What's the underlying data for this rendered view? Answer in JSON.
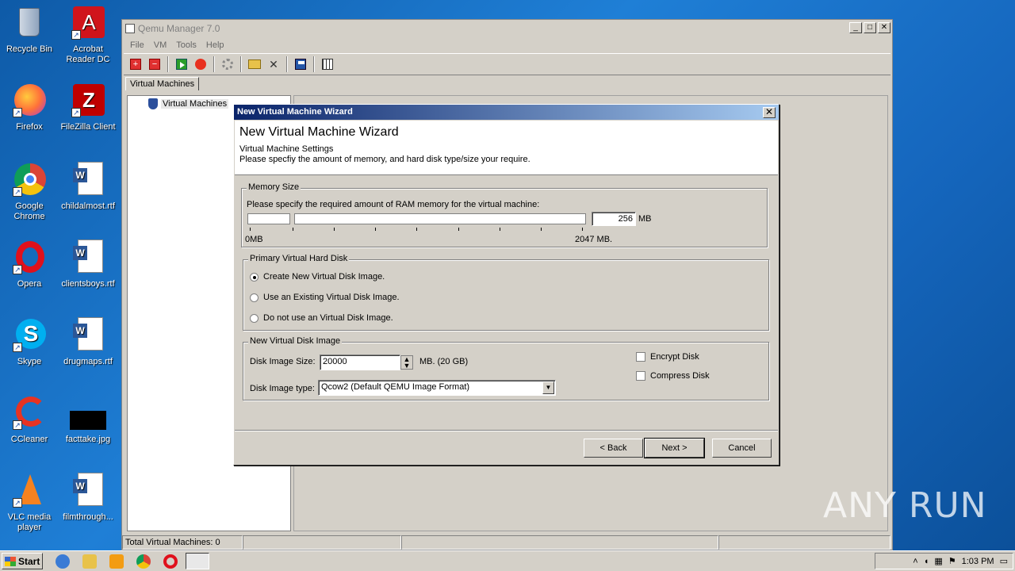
{
  "desktop": {
    "icons": [
      {
        "label": "Recycle Bin"
      },
      {
        "label": "Acrobat Reader DC"
      },
      {
        "label": "Firefox"
      },
      {
        "label": "FileZilla Client"
      },
      {
        "label": "Google Chrome"
      },
      {
        "label": "childalmost.rtf"
      },
      {
        "label": "Opera"
      },
      {
        "label": "clientsboys.rtf"
      },
      {
        "label": "Skype"
      },
      {
        "label": "drugmaps.rtf"
      },
      {
        "label": "CCleaner"
      },
      {
        "label": "facttake.jpg"
      },
      {
        "label": "VLC media player"
      },
      {
        "label": "filmthrough..."
      }
    ]
  },
  "app": {
    "title": "Qemu Manager 7.0",
    "menu": [
      "File",
      "VM",
      "Tools",
      "Help"
    ],
    "tab": "Virtual Machines",
    "tree_root": "Virtual Machines",
    "status": "Total Virtual Machines: 0"
  },
  "dialog": {
    "title_bar": "New Virtual Machine Wizard",
    "heading": "New Virtual Machine Wizard",
    "subheading": "Virtual Machine Settings",
    "description": "Please specfiy the amount of memory, and hard disk type/size your require.",
    "memory": {
      "group_title": "Memory Size",
      "prompt": "Please specify the required amount of RAM memory for the virtual machine:",
      "value": "256",
      "unit": "MB",
      "min_label": "0MB",
      "max_label": "2047 MB.",
      "slider_fraction": 0.125
    },
    "disk": {
      "group_title": "Primary Virtual Hard Disk",
      "options": [
        {
          "label": "Create New Virtual Disk Image.",
          "selected": true
        },
        {
          "label": "Use an  Existing Virtual Disk Image.",
          "selected": false
        },
        {
          "label": "Do not use an Virtual Disk Image.",
          "selected": false
        }
      ]
    },
    "new_image": {
      "group_title": "New Virtual Disk Image",
      "size_label": "Disk Image Size:",
      "size_value": "20000",
      "size_hint": "MB. (20 GB)",
      "type_label": "Disk Image type:",
      "type_value": "Qcow2  (Default QEMU Image Format)",
      "encrypt_label": "Encrypt Disk",
      "compress_label": "Compress Disk"
    },
    "buttons": {
      "back": "< Back",
      "next": "Next >",
      "cancel": "Cancel"
    }
  },
  "taskbar": {
    "start": "Start",
    "clock": "1:03 PM"
  },
  "watermark": "ANY RUN"
}
